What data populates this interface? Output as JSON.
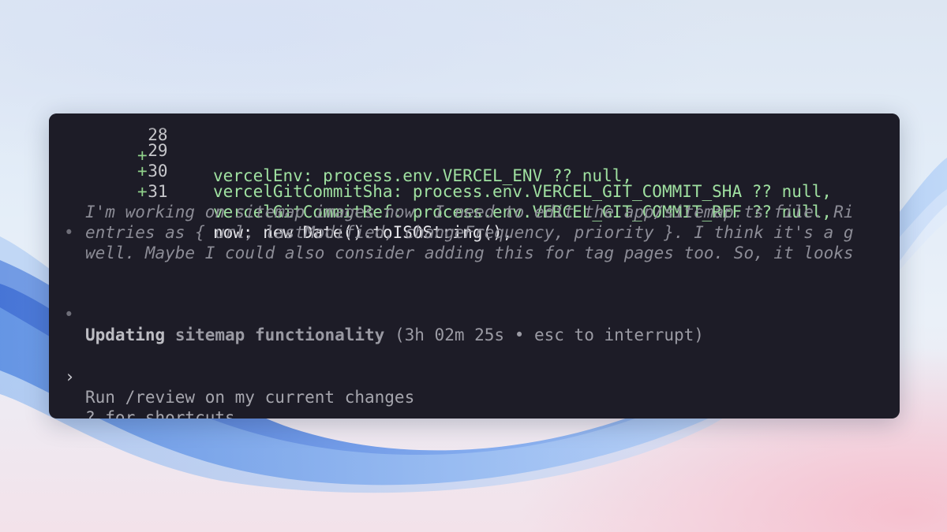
{
  "diff": {
    "partial_line": {
      "number": "28",
      "sign": "+",
      "code": "vercelEnv: process.env.VERCEL_ENV ?? null,"
    },
    "lines": [
      {
        "number": "29",
        "sign": "+",
        "code": "vercelGitCommitSha: process.env.VERCEL_GIT_COMMIT_SHA ?? null,",
        "added": true
      },
      {
        "number": "30",
        "sign": "+",
        "code": "vercelGitCommitRef: process.env.VERCEL_GIT_COMMIT_REF ?? null,",
        "added": true
      },
      {
        "number": "31",
        "sign": "",
        "code": "now: new Date().toISOString(),",
        "added": false
      }
    ]
  },
  "assistant_message": {
    "bullet": "•",
    "lines": [
      "I'm working on sitemap images now. I need to edit the app/sitemap.ts file. Ri",
      "entries as { url, lastModified, changeFrequency, priority }. I think it's a g",
      "well. Maybe I could also consider adding this for tag pages too. So, it looks"
    ]
  },
  "status": {
    "bullet": "•",
    "word1": "Updating",
    "word2": "sitemap functionality",
    "meta": "(3h 02m 25s • esc to interrupt)"
  },
  "prompt": {
    "caret": "›",
    "placeholder": "Run /review on my current changes"
  },
  "hint": "? for shortcuts",
  "colors": {
    "terminal_bg": "#1d1c27",
    "added_code": "#9fe0a0",
    "accent_wave": "#3f7be0"
  }
}
